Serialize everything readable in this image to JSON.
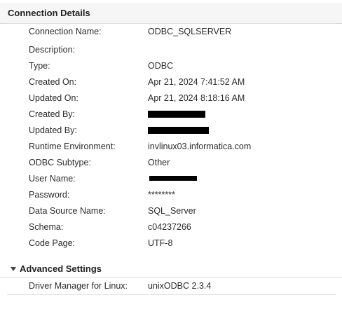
{
  "connection_details": {
    "title": "Connection Details",
    "fields": [
      {
        "label": "Connection Name:",
        "value": "ODBC_SQLSERVER"
      },
      {
        "label": "Description:",
        "value": ""
      },
      {
        "label": "Type:",
        "value": "ODBC"
      },
      {
        "label": "Created On:",
        "value": "Apr 21, 2024 7:41:52 AM"
      },
      {
        "label": "Updated On:",
        "value": "Apr 21, 2024 8:18:16 AM"
      },
      {
        "label": "Created By:",
        "value": ""
      },
      {
        "label": "Updated By:",
        "value": ""
      },
      {
        "label": "Runtime Environment:",
        "value": "invlinux03.informatica.com"
      },
      {
        "label": "ODBC Subtype:",
        "value": "Other"
      },
      {
        "label": "User Name:",
        "value": ""
      },
      {
        "label": "Password:",
        "value": "********"
      },
      {
        "label": "Data Source Name:",
        "value": "SQL_Server"
      },
      {
        "label": "Schema:",
        "value": "c04237266"
      },
      {
        "label": "Code Page:",
        "value": "UTF-8"
      }
    ]
  },
  "advanced_settings": {
    "title": "Advanced Settings",
    "fields": [
      {
        "label": "Driver Manager for Linux:",
        "value": "unixODBC 2.3.4"
      }
    ]
  }
}
